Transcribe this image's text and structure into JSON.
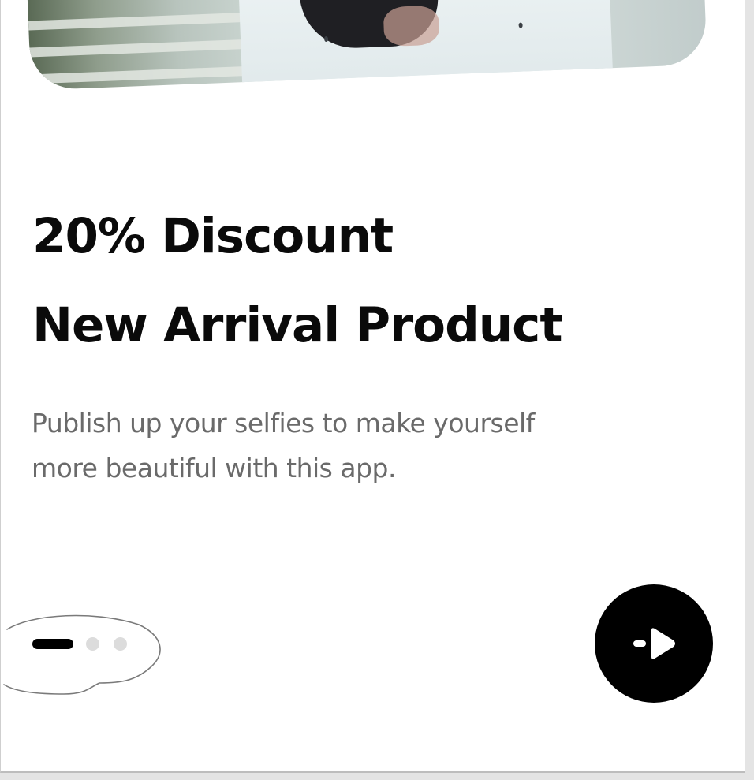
{
  "onboarding": {
    "title_line_1": "20% Discount",
    "title_line_2": "New Arrival Product",
    "subtitle_line_1": "Publish up your selfies to make yourself",
    "subtitle_line_2": "more beautiful with this app.",
    "pagination": {
      "total": 3,
      "active_index": 0
    },
    "next_button_icon": "arrow-right-icon"
  },
  "colors": {
    "background": "#ffffff",
    "title": "#0a0a0a",
    "subtitle": "#6a6a6a",
    "accent": "#000000",
    "inactive_dot": "#dcdcdc"
  }
}
